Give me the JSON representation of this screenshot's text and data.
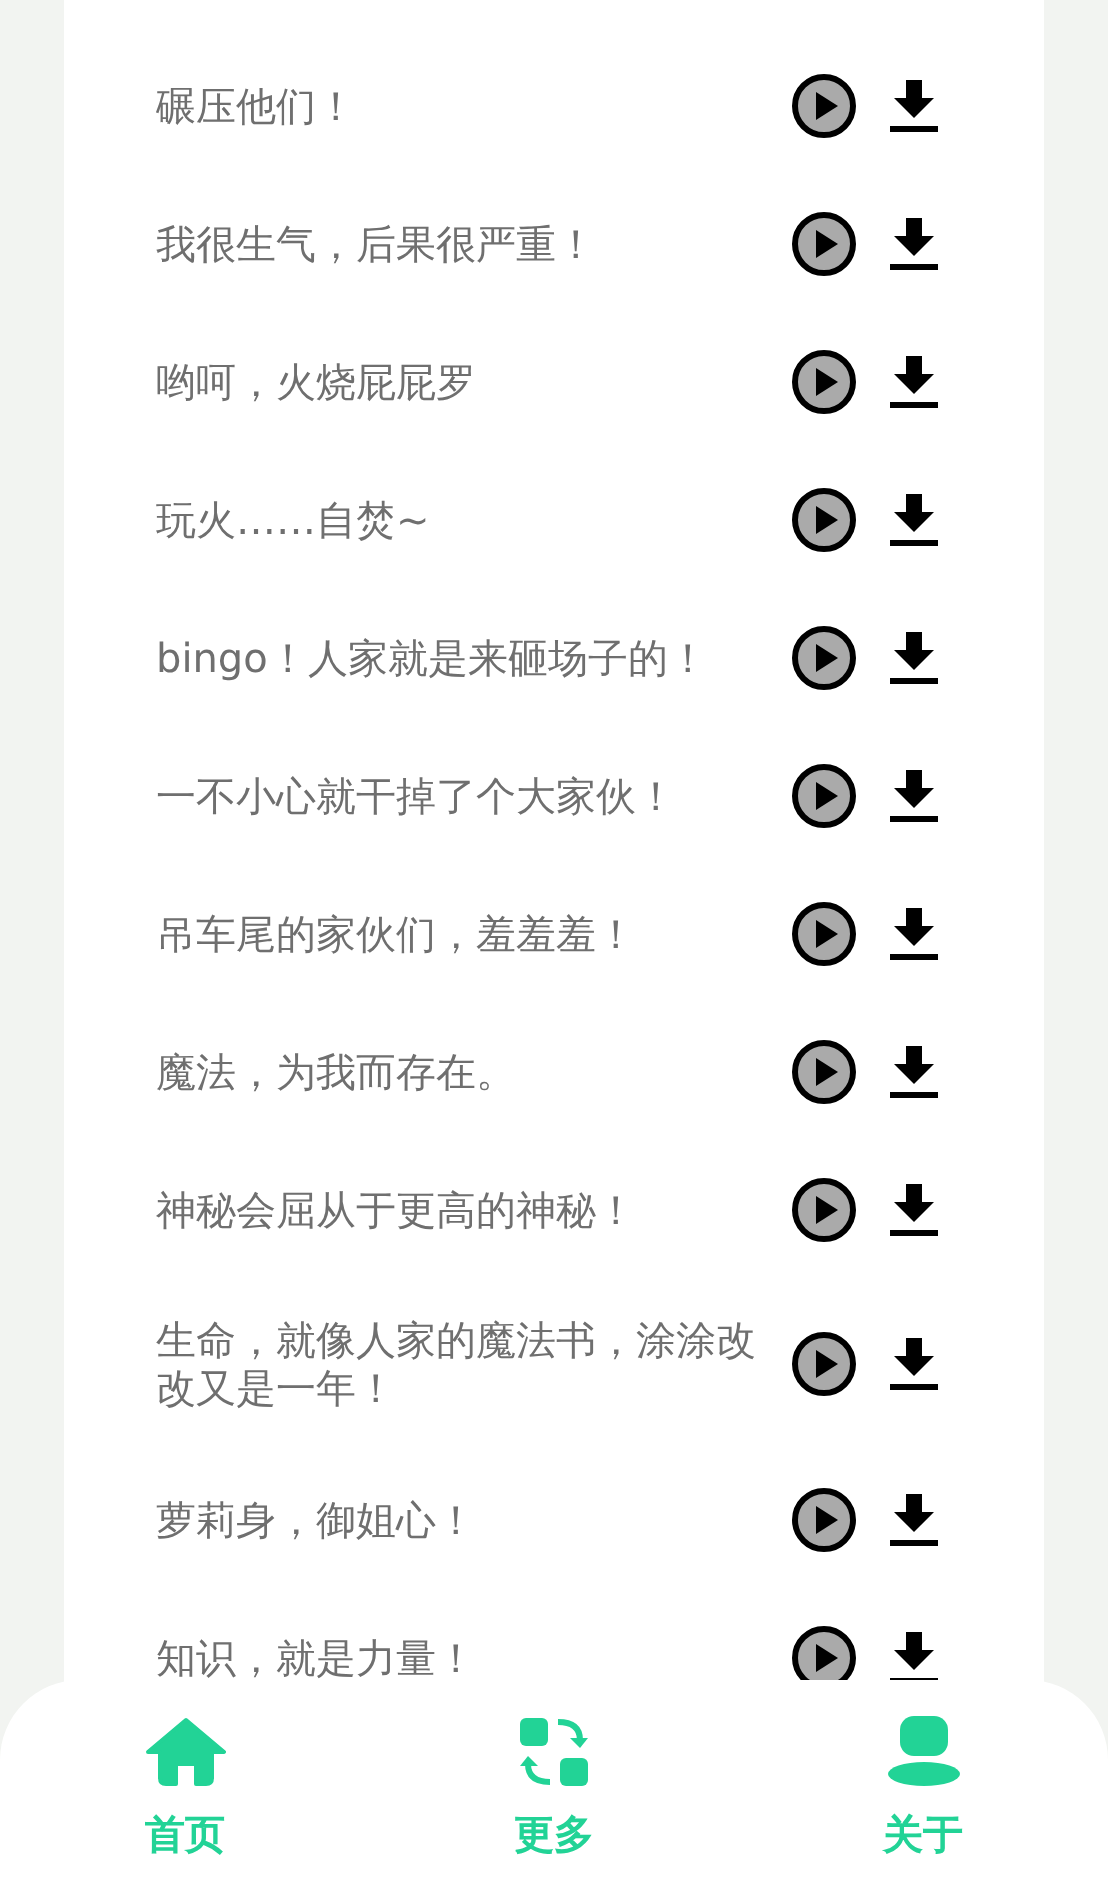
{
  "clips": [
    {
      "text": "碾压他们！"
    },
    {
      "text": "我很生气，后果很严重！"
    },
    {
      "text": "哟呵，火烧屁屁罗"
    },
    {
      "text": "玩火……自焚~"
    },
    {
      "text": "bingo！人家就是来砸场子的！"
    },
    {
      "text": "一不小心就干掉了个大家伙！"
    },
    {
      "text": "吊车尾的家伙们，羞羞羞！"
    },
    {
      "text": "魔法，为我而存在。"
    },
    {
      "text": "神秘会屈从于更高的神秘！"
    },
    {
      "text": "生命，就像人家的魔法书，涂涂改改又是一年！"
    },
    {
      "text": "萝莉身，御姐心！"
    },
    {
      "text": "知识，就是力量！"
    }
  ],
  "tabs": [
    {
      "label": "首页",
      "kind": "home"
    },
    {
      "label": "更多",
      "kind": "more"
    },
    {
      "label": "关于",
      "kind": "about"
    }
  ]
}
